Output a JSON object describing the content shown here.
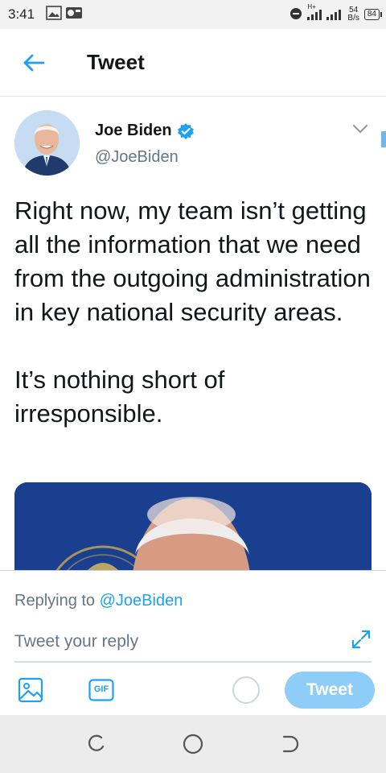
{
  "status_bar": {
    "time": "3:41",
    "network_type": "H+",
    "speed_value": "54",
    "speed_unit": "B/s",
    "battery": "84"
  },
  "header": {
    "title": "Tweet"
  },
  "tweet": {
    "author_name": "Joe Biden",
    "author_handle": "@JoeBiden",
    "verified": true,
    "text": "Right now, my team isn’t getting all the information that we need from the outgoing administration in key national security areas.\n\nIt’s nothing short of irresponsible."
  },
  "composer": {
    "replying_prefix": "Replying to ",
    "replying_handle": "@JoeBiden",
    "placeholder": "Tweet your reply",
    "gif_label": "GIF",
    "tweet_button": "Tweet"
  },
  "colors": {
    "accent": "#1da1f2",
    "tweet_button_disabled": "#8ecdf7",
    "secondary_text": "#657786",
    "media_bg": "#1b3f8f"
  },
  "icons": {
    "back": "arrow-left-icon",
    "verified": "verified-badge-icon",
    "more": "chevron-down-icon",
    "expand": "expand-icon",
    "image": "image-icon",
    "gif": "gif-icon",
    "nav_back": "nav-back-icon",
    "nav_home": "nav-home-icon",
    "nav_recents": "nav-recents-icon"
  }
}
